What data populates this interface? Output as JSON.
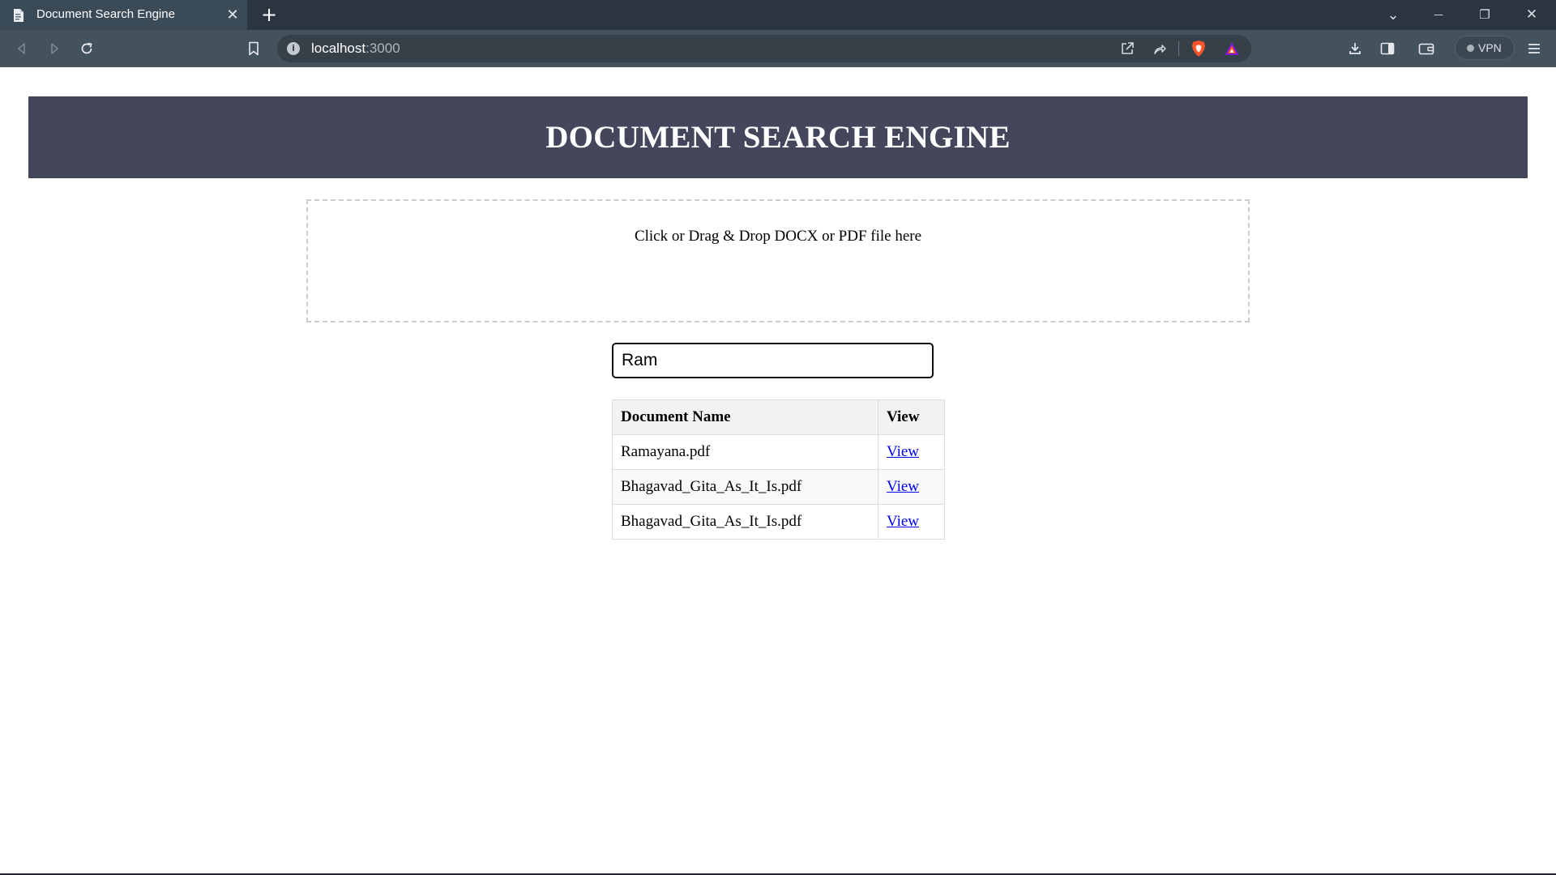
{
  "browser": {
    "tab": {
      "title": "Document Search Engine",
      "close_glyph": "✕"
    },
    "new_tab_glyph": "+",
    "window_controls": {
      "tab_list_glyph": "⌄",
      "minimize_glyph": "—",
      "restore_glyph": "❐",
      "close_glyph": "✕"
    },
    "address": {
      "host": "localhost",
      "port": ":3000"
    },
    "vpn_label": "VPN",
    "icons": {
      "back": "back-arrow-icon",
      "forward": "forward-arrow-icon",
      "reload": "reload-icon",
      "bookmark": "bookmark-icon",
      "site_info": "info-icon",
      "open_external": "open-external-icon",
      "share": "share-icon",
      "brave_shields": "brave-shields-icon",
      "brave_rewards": "brave-rewards-icon",
      "downloads": "download-icon",
      "sidebar": "sidebar-icon",
      "wallet": "wallet-icon",
      "menu": "hamburger-menu-icon"
    },
    "colors": {
      "tabstrip": "#2b3540",
      "active_tab": "#3a4a57",
      "toolbar": "#44525e",
      "urlbar": "#354049",
      "brave_orange": "#fb542b",
      "rewards_purple": "#6e1ed6"
    }
  },
  "page": {
    "header_title": "DOCUMENT SEARCH ENGINE",
    "dropzone_text": "Click or Drag & Drop DOCX or PDF file here",
    "search": {
      "value": "Ram",
      "placeholder": ""
    },
    "table": {
      "headers": {
        "name": "Document Name",
        "view": "View"
      },
      "rows": [
        {
          "name": "Ramayana.pdf",
          "view": "View"
        },
        {
          "name": "Bhagavad_Gita_As_It_Is.pdf",
          "view": "View"
        },
        {
          "name": "Bhagavad_Gita_As_It_Is.pdf",
          "view": "View"
        }
      ]
    },
    "colors": {
      "header_bg": "#44475c",
      "header_text": "#ffffff",
      "link": "#0000ee",
      "table_header_bg": "#f2f2f2",
      "table_border": "#dddddd"
    }
  }
}
